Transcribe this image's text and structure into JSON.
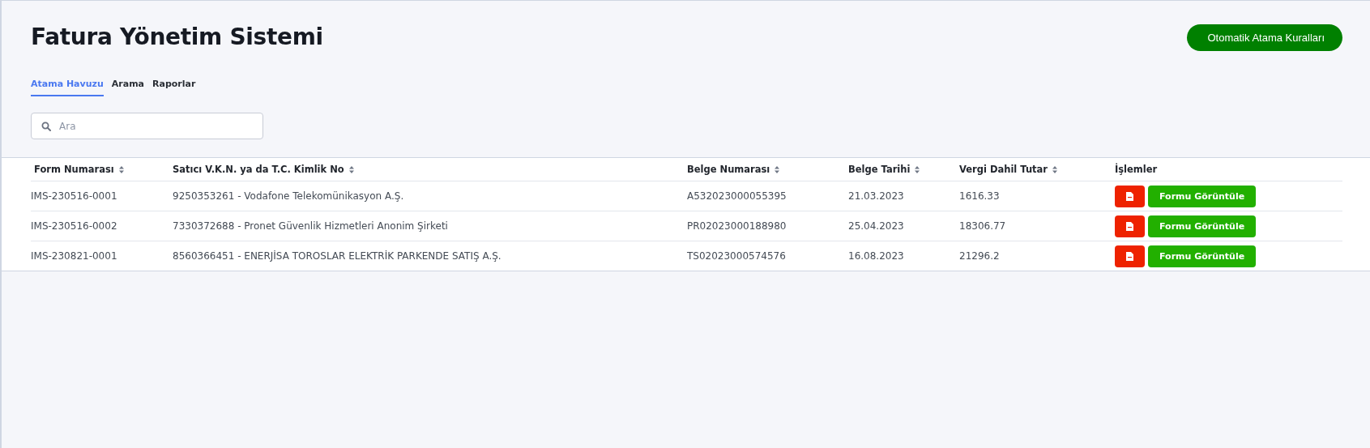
{
  "header": {
    "title": "Fatura Yönetim Sistemi",
    "action_button": "Otomatik Atama Kuralları"
  },
  "tabs": [
    {
      "label": "Atama Havuzu",
      "selected": true
    },
    {
      "label": "Arama",
      "selected": false
    },
    {
      "label": "Raporlar",
      "selected": false
    }
  ],
  "search": {
    "placeholder": "Ara"
  },
  "table": {
    "columns": [
      {
        "label": "Form Numarası",
        "sortable": true
      },
      {
        "label": "Satıcı V.K.N. ya da T.C. Kimlik No",
        "sortable": true
      },
      {
        "label": "Belge Numarası",
        "sortable": true
      },
      {
        "label": "Belge Tarihi",
        "sortable": true
      },
      {
        "label": "Vergi Dahil Tutar",
        "sortable": true
      },
      {
        "label": "İşlemler",
        "sortable": false
      }
    ],
    "rows": [
      {
        "cells": [
          "IMS-230516-0001",
          "9250353261 - Vodafone Telekomünikasyon A.Ş.",
          "A532023000055395",
          "21.03.2023",
          "1616.33"
        ],
        "action": "Formu Görüntüle"
      },
      {
        "cells": [
          "IMS-230516-0002",
          "7330372688 - Pronet Güvenlik Hizmetleri Anonim Şirketi",
          "PR02023000188980",
          "25.04.2023",
          "18306.77"
        ],
        "action": "Formu Görüntüle"
      },
      {
        "cells": [
          "IMS-230821-0001",
          "8560366451 - ENERJİSA TOROSLAR ELEKTRİK PARKENDE SATIŞ A.Ş.",
          "TS02023000574576",
          "16.08.2023",
          "21296.2"
        ],
        "action": "Formu Görüntüle"
      }
    ]
  }
}
